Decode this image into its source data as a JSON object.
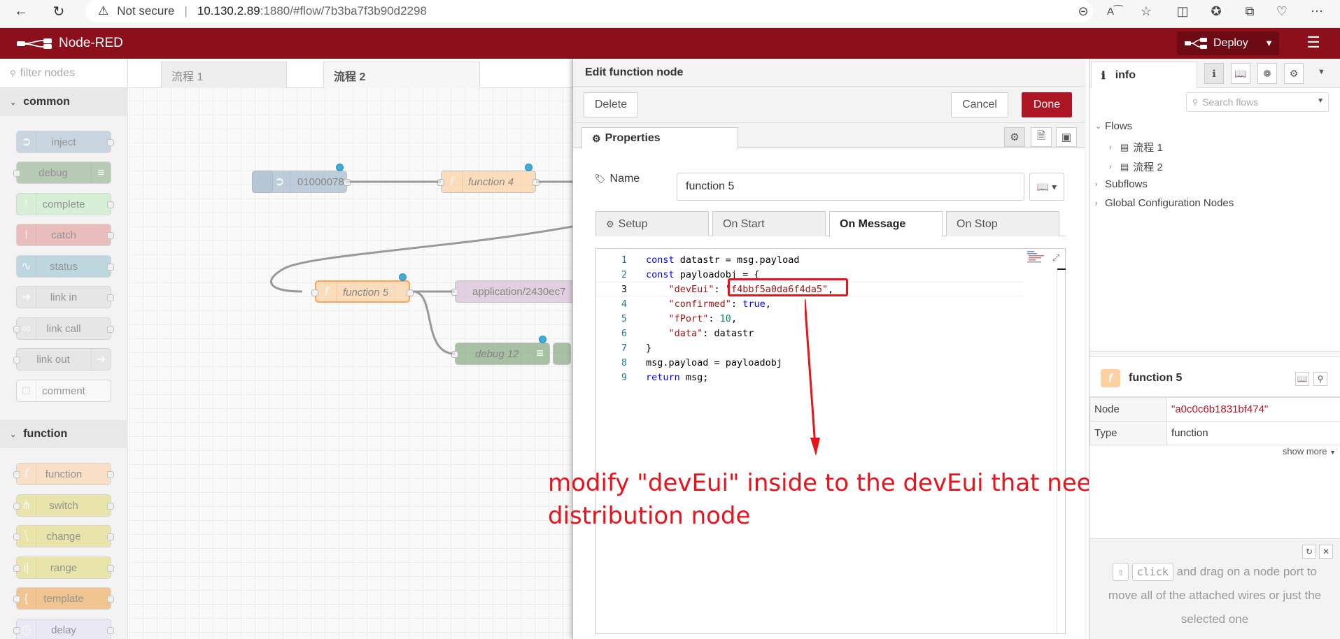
{
  "browser": {
    "security": "Not secure",
    "url_host": "10.130.2.89",
    "url_rest": ":1880/#flow/7b3ba7f3b90d2298"
  },
  "header": {
    "title": "Node-RED",
    "deploy_label": "Deploy",
    "brand_color": "#8c101c"
  },
  "palette": {
    "search_placeholder": "filter nodes",
    "categories": [
      "common",
      "function"
    ],
    "common_nodes": [
      "inject",
      "debug",
      "complete",
      "catch",
      "status",
      "link in",
      "link call",
      "link out",
      "comment"
    ],
    "function_nodes": [
      "function",
      "switch",
      "change",
      "range",
      "template",
      "delay"
    ]
  },
  "workspace": {
    "tabs": [
      "流程 1",
      "流程 2"
    ],
    "nodes": {
      "inject": "01000078",
      "function4": "function 4",
      "function5": "function 5",
      "mqtt": "application/2430ec7",
      "debug12": "debug 12"
    }
  },
  "tray": {
    "title": "Edit function node",
    "delete_label": "Delete",
    "cancel_label": "Cancel",
    "done_label": "Done",
    "properties_tab": "Properties",
    "name_label": "Name",
    "name_value": "function 5",
    "fn_tabs": [
      "Setup",
      "On Start",
      "On Message",
      "On Stop"
    ],
    "code": {
      "line_numbers": [
        "1",
        "2",
        "3",
        "4",
        "5",
        "6",
        "7",
        "8",
        "9"
      ],
      "l1a": "const",
      "l1b": " datastr = msg.payload",
      "l2a": "const",
      "l2b": " payloadobj = {",
      "l3a": "    \"devEui\"",
      "l3b": ": ",
      "l3c": "\"f4bbf5a0da6f4da5\"",
      "l3d": ",",
      "l4a": "    \"confirmed\"",
      "l4b": ": ",
      "l4c": "true",
      "l4d": ",",
      "l5a": "    \"fPort\"",
      "l5b": ": ",
      "l5c": "10",
      "l5d": ",",
      "l6a": "    \"data\"",
      "l6b": ": datastr",
      "l7": "}",
      "l8": "msg.payload = payloadobj",
      "l9a": "return",
      "l9b": " msg;"
    }
  },
  "annotation": {
    "text": "modify \"devEui\" inside to the devEui that needs to receive the distribution node",
    "color": "#e8131b"
  },
  "sidebar": {
    "tab_label": "info",
    "search_placeholder": "Search flows",
    "tree": {
      "flows": "Flows",
      "flow1": "流程 1",
      "flow2": "流程 2",
      "subflows": "Subflows",
      "global": "Global Configuration Nodes"
    },
    "node_title": "function 5",
    "node_key": "Node",
    "node_value": "\"a0c0c6b1831bf474\"",
    "type_key": "Type",
    "type_value": "function",
    "show_more": "show more",
    "tip": {
      "key1": "⇧",
      "key2": "click",
      "text1": " and drag on a node port to move all of the attached wires or just the selected one"
    }
  }
}
